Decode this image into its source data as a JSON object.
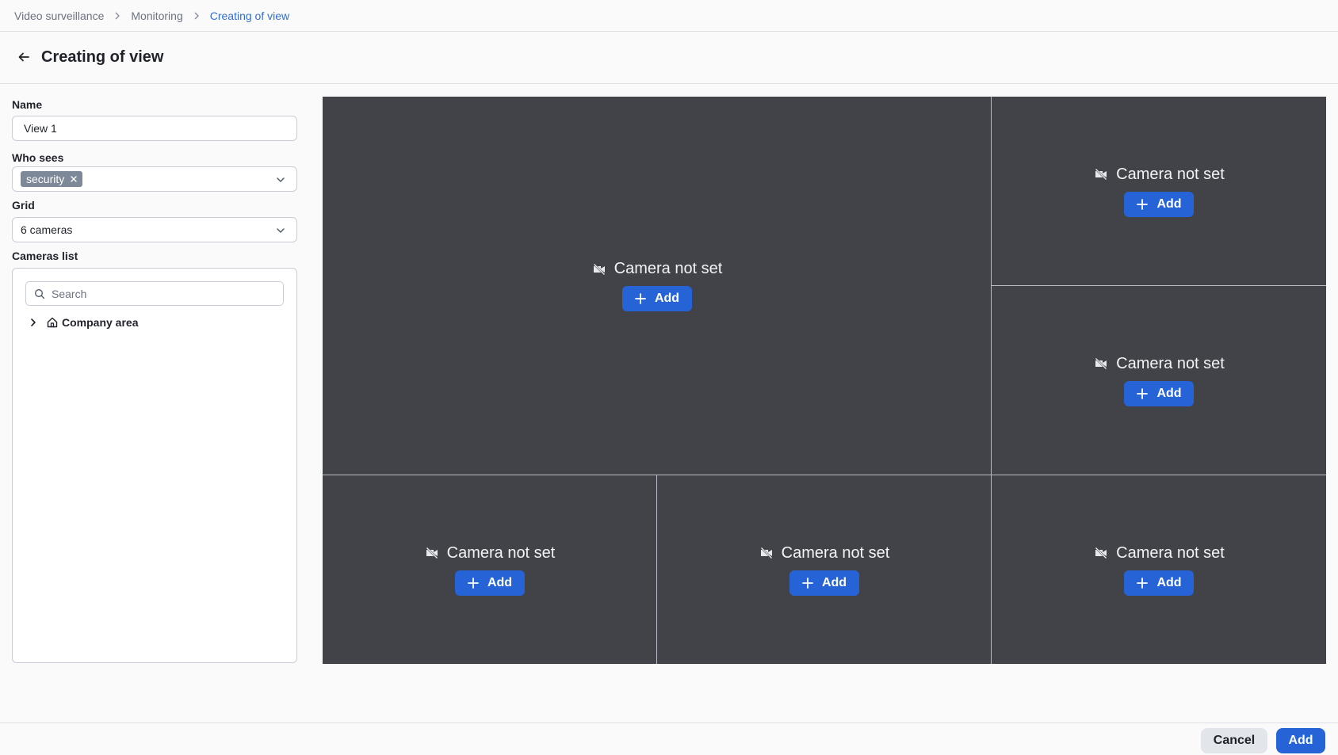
{
  "breadcrumb": {
    "items": [
      "Video surveillance",
      "Monitoring",
      "Creating of view"
    ]
  },
  "header": {
    "title": "Creating of view",
    "back_icon": "arrow-left-icon"
  },
  "form": {
    "name_label": "Name",
    "name_value": "View 1",
    "who_sees_label": "Who sees",
    "who_sees_tags": [
      "security"
    ],
    "grid_label": "Grid",
    "grid_value": "6 cameras",
    "cameras_list_label": "Cameras list",
    "search_placeholder": "Search",
    "tree": [
      {
        "label": "Company area",
        "icon": "home-icon",
        "expanded": false
      }
    ]
  },
  "grid": {
    "cells": [
      {
        "title": "Camera not set",
        "button": "Add"
      },
      {
        "title": "Camera not set",
        "button": "Add"
      },
      {
        "title": "Camera not set",
        "button": "Add"
      },
      {
        "title": "Camera not set",
        "button": "Add"
      },
      {
        "title": "Camera not set",
        "button": "Add"
      },
      {
        "title": "Camera not set",
        "button": "Add"
      }
    ]
  },
  "footer": {
    "cancel_label": "Cancel",
    "submit_label": "Add"
  },
  "colors": {
    "accent": "#2563d6",
    "grid_background": "#424348",
    "tag_background": "#7d8898",
    "breadcrumb_current": "#2f6fd6"
  }
}
